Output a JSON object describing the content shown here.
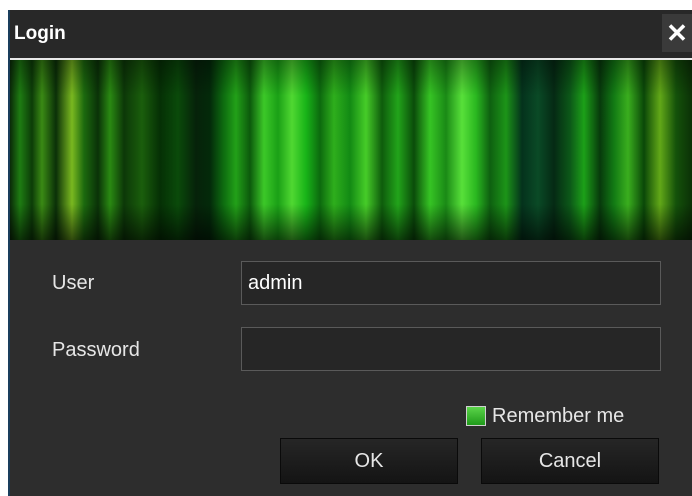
{
  "window": {
    "title": "Login",
    "close_icon": "close-icon"
  },
  "form": {
    "user_label": "User",
    "user_value": "admin",
    "password_label": "Password",
    "password_value": "",
    "remember_label": "Remember me",
    "remember_checked": true
  },
  "buttons": {
    "ok_label": "OK",
    "cancel_label": "Cancel"
  },
  "colors": {
    "background": "#2d2d2d",
    "accent": "#2ab820"
  }
}
